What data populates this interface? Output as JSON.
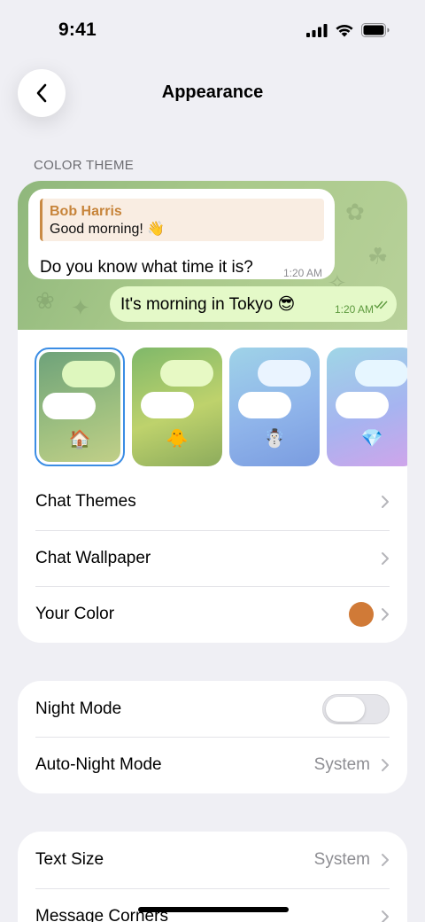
{
  "status": {
    "time": "9:41"
  },
  "header": {
    "title": "Appearance"
  },
  "color_theme": {
    "section_label": "COLOR THEME",
    "preview": {
      "reply_name": "Bob Harris",
      "reply_text": "Good morning! 👋",
      "incoming_text": "Do you know what time it is?",
      "incoming_time": "1:20 AM",
      "outgoing_text": "It's morning in Tokyo 😎",
      "outgoing_time": "1:20 AM"
    },
    "thumbnails": [
      {
        "emoji": "🏠",
        "selected": true
      },
      {
        "emoji": "🐥",
        "selected": false
      },
      {
        "emoji": "☃️",
        "selected": false
      },
      {
        "emoji": "💎",
        "selected": false
      }
    ],
    "rows": {
      "chat_themes": "Chat Themes",
      "chat_wallpaper": "Chat Wallpaper",
      "your_color": "Your Color"
    },
    "accent_color": "#d07a37"
  },
  "night": {
    "night_mode": "Night Mode",
    "night_mode_on": false,
    "auto_night": "Auto-Night Mode",
    "auto_night_value": "System"
  },
  "text": {
    "text_size": "Text Size",
    "text_size_value": "System",
    "message_corners": "Message Corners"
  }
}
